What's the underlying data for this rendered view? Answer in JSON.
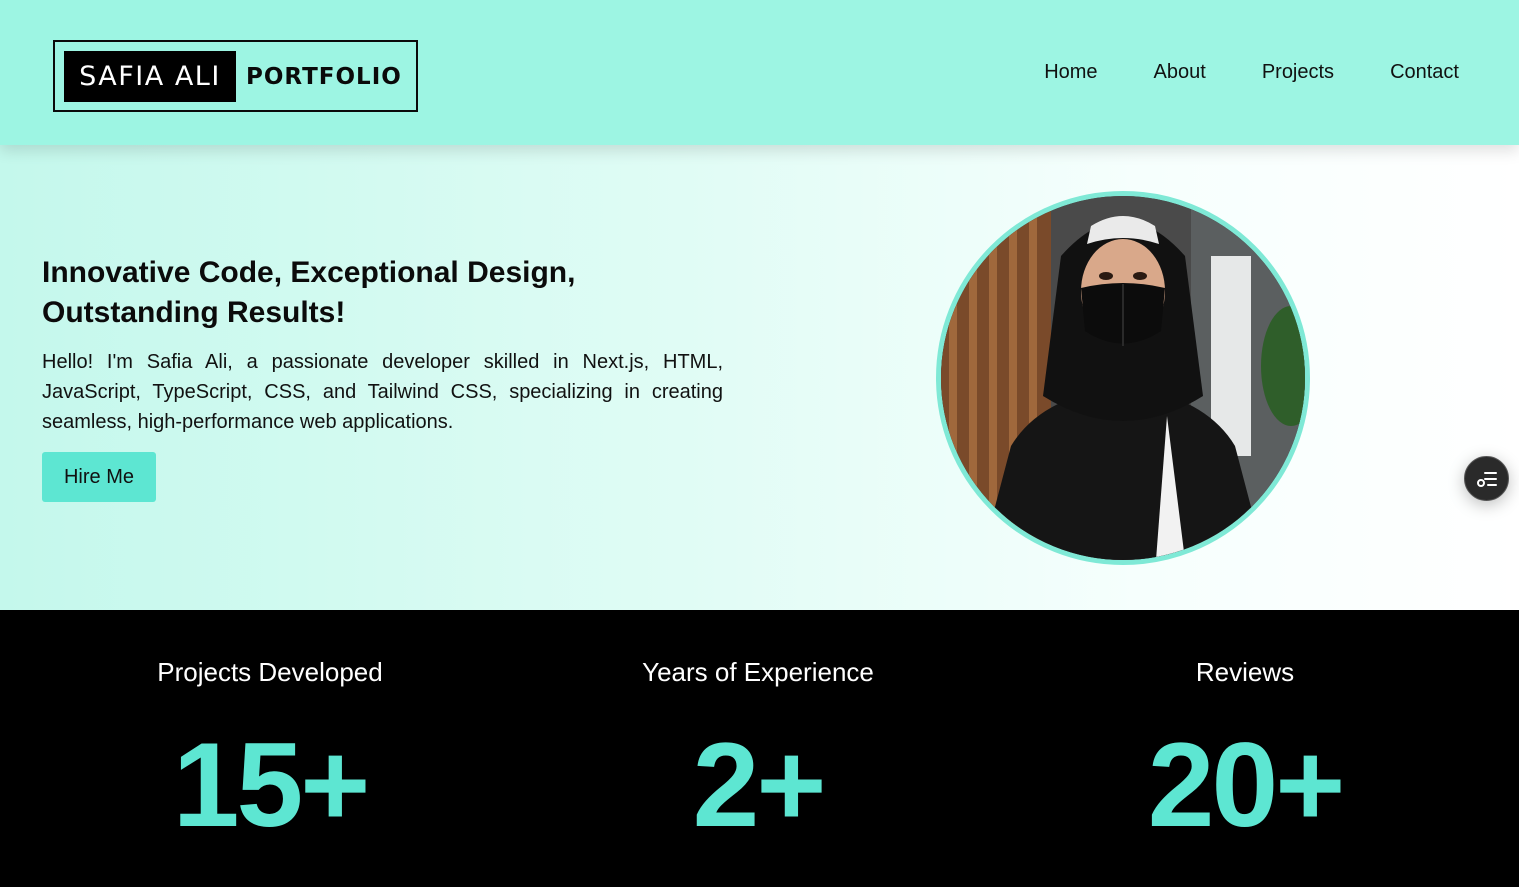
{
  "header": {
    "logo_name": "SAFIA ALI",
    "logo_word": "PORTFOLIO",
    "nav": [
      "Home",
      "About",
      "Projects",
      "Contact"
    ]
  },
  "hero": {
    "title": "Innovative Code, Exceptional Design, Outstanding Results!",
    "text": "Hello! I'm Safia Ali, a passionate developer skilled in Next.js, HTML, JavaScript, TypeScript, CSS, and Tailwind CSS, specializing in creating seamless, high-performance web applications.",
    "cta": "Hire Me"
  },
  "stats": [
    {
      "label": "Projects Developed",
      "value": "15+"
    },
    {
      "label": "Years of Experience",
      "value": "2+"
    },
    {
      "label": "Reviews",
      "value": "20+"
    }
  ],
  "colors": {
    "header_bg": "#9df5e3",
    "accent": "#5de6d2",
    "stats_bg": "#000000"
  },
  "icons": {
    "floating_button": "list-settings-icon"
  }
}
